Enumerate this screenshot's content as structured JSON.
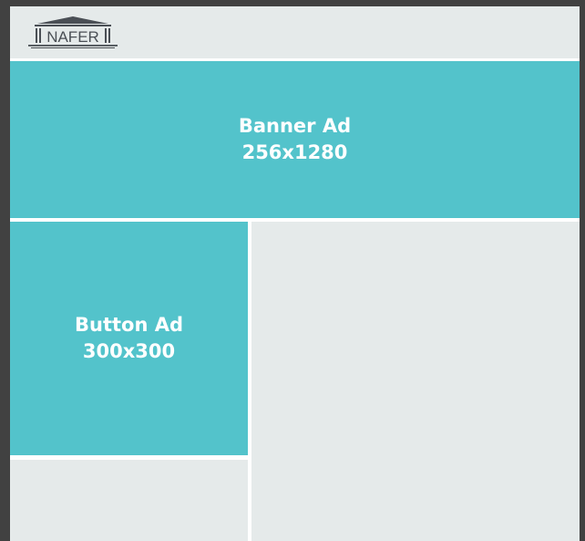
{
  "header": {
    "logo_text": "NAFER"
  },
  "banner_ad": {
    "title": "Banner Ad",
    "size": "256x1280"
  },
  "button_ad": {
    "title": "Button Ad",
    "size": "300x300"
  },
  "colors": {
    "background": "#414141",
    "panel": "#e5eaea",
    "ad": "#53c3cb",
    "ad_text": "#ffffff",
    "logo": "#4a4f55"
  }
}
